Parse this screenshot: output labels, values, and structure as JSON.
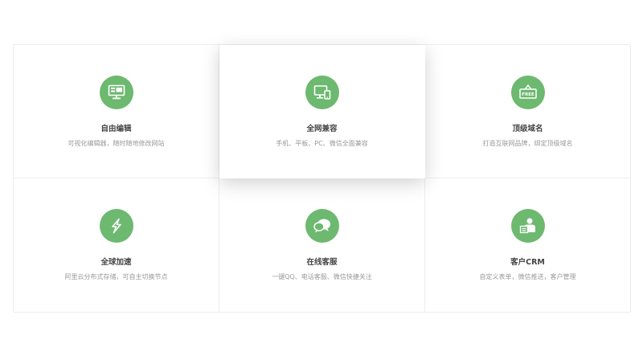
{
  "accent_color": "#6cb96f",
  "features": [
    {
      "title": "自由编辑",
      "desc": "可视化编辑器，随时随地修改网站",
      "icon": "monitor-editor-icon"
    },
    {
      "title": "全网兼容",
      "desc": "手机、平板、PC、微信全面兼容",
      "icon": "multi-device-icon"
    },
    {
      "title": "顶级域名",
      "desc": "打造互联网品牌，绑定顶级域名",
      "icon": "free-domain-sign-icon",
      "icon_text": "FREE"
    },
    {
      "title": "全球加速",
      "desc": "阿里云分布式存储，可自主切换节点",
      "icon": "lightning-icon"
    },
    {
      "title": "在线客服",
      "desc": "一键QQ、电话客服、微信快捷关注",
      "icon": "chat-bubbles-icon"
    },
    {
      "title": "客户CRM",
      "desc": "自定义表单，微信推送，客户管理",
      "icon": "customer-profile-icon"
    }
  ]
}
